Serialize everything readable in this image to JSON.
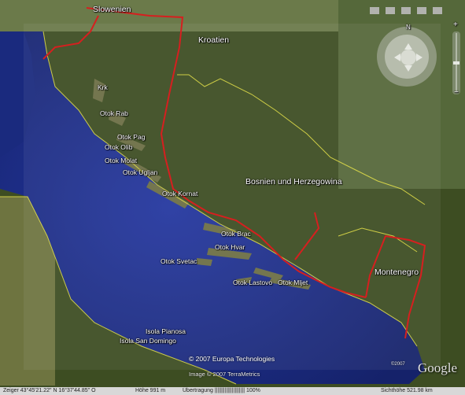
{
  "map": {
    "countries": {
      "slovenia": "Slowenien",
      "croatia": "Kroatien",
      "bosnia": "Bosnien und Herzegowina",
      "montenegro": "Montenegro"
    },
    "islands": [
      {
        "key": "krk",
        "label": "Krk"
      },
      {
        "key": "rab",
        "label": "Otok Rab"
      },
      {
        "key": "pag",
        "label": "Otok Pag"
      },
      {
        "key": "olib",
        "label": "Otok Olib"
      },
      {
        "key": "molat",
        "label": "Otok Molat"
      },
      {
        "key": "ugljan",
        "label": "Otok Ugljan"
      },
      {
        "key": "kornat",
        "label": "Otok Kornat"
      },
      {
        "key": "brac",
        "label": "Otok Brac"
      },
      {
        "key": "hvar",
        "label": "Otok Hvar"
      },
      {
        "key": "svetac",
        "label": "Otok Svetac"
      },
      {
        "key": "lastovo",
        "label": "Otok Lastovo"
      },
      {
        "key": "mljet",
        "label": "Otok Mljet"
      },
      {
        "key": "pianosa",
        "label": "Isola Pianosa"
      },
      {
        "key": "sandomingo",
        "label": "Isola San Domingo"
      }
    ],
    "copyright_1": "© 2007 Europa Technologies",
    "copyright_2": "Image © 2007 TerraMetrics",
    "logo": "Google",
    "logo_year": "©2007"
  },
  "navigation": {
    "north_label": "N",
    "zoom_in": "+",
    "zoom_out": "−"
  },
  "status_bar": {
    "pointer": "Zeiger  43°45'21.22\" N   16°37'44.85\" O",
    "elevation": "Höhe  991 m",
    "streaming": "Übertragung ||||||||||||||||||||| 100%",
    "eye_altitude": "Sichthöhe   521.98 km"
  },
  "colors": {
    "sea": "#1c2f8a",
    "border": "#d61f1f",
    "admin_line": "#e6e24a"
  }
}
